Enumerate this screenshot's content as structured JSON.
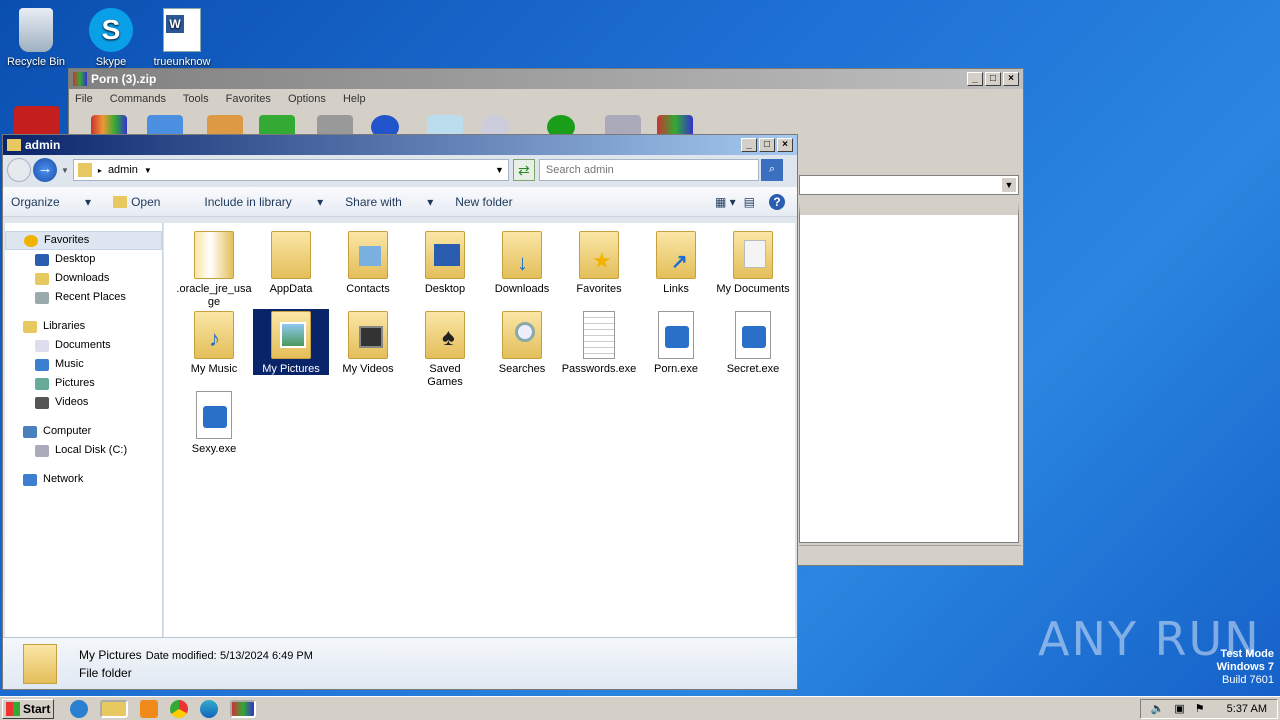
{
  "desktop": {
    "icons": [
      {
        "label": "Recycle Bin"
      },
      {
        "label": "Skype"
      },
      {
        "label": "trueunknow"
      }
    ]
  },
  "zipwin": {
    "title": "Porn (3).zip",
    "menu": [
      "File",
      "Commands",
      "Tools",
      "Favorites",
      "Options",
      "Help"
    ]
  },
  "explorer": {
    "title": "admin",
    "breadcrumb": "admin",
    "search_placeholder": "Search admin",
    "commands": [
      "Organize",
      "Open",
      "Include in library",
      "Share with",
      "New folder"
    ],
    "nav": {
      "favorites": "Favorites",
      "desktop": "Desktop",
      "downloads": "Downloads",
      "recent": "Recent Places",
      "libraries": "Libraries",
      "documents": "Documents",
      "music": "Music",
      "pictures": "Pictures",
      "videos": "Videos",
      "computer": "Computer",
      "localdisk": "Local Disk (C:)",
      "network": "Network"
    },
    "items": [
      {
        "label": ".oracle_jre_usage"
      },
      {
        "label": "AppData"
      },
      {
        "label": "Contacts"
      },
      {
        "label": "Desktop"
      },
      {
        "label": "Downloads"
      },
      {
        "label": "Favorites"
      },
      {
        "label": "Links"
      },
      {
        "label": "My Documents"
      },
      {
        "label": "My Music"
      },
      {
        "label": "My Pictures"
      },
      {
        "label": "My Videos"
      },
      {
        "label": "Saved Games"
      },
      {
        "label": "Searches"
      },
      {
        "label": "Passwords.exe"
      },
      {
        "label": "Porn.exe"
      },
      {
        "label": "Secret.exe"
      },
      {
        "label": "Sexy.exe"
      }
    ],
    "status": {
      "name": "My Pictures",
      "modified_label": "Date modified:",
      "modified": "5/13/2024 6:49 PM",
      "type": "File folder"
    }
  },
  "taskbar": {
    "start": "Start",
    "clock": "5:37 AM"
  },
  "watermark": {
    "brand": "ANY RUN",
    "mode": "Test Mode",
    "os": "Windows 7",
    "build": "Build 7601"
  },
  "colors": {
    "selection": "#0a246a",
    "titlebar": "#0a246a",
    "desktop": "#1e6fd4"
  }
}
